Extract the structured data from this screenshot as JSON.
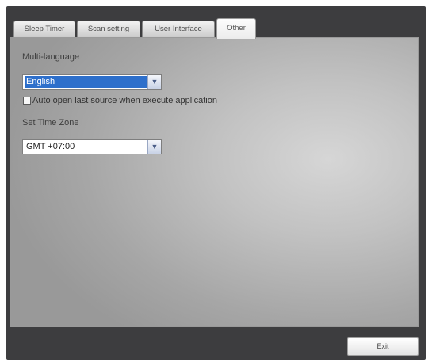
{
  "tabs": [
    {
      "label": "Sleep Timer",
      "active": false
    },
    {
      "label": "Scan setting",
      "active": false
    },
    {
      "label": "User Interface",
      "active": false
    },
    {
      "label": "Other",
      "active": true
    }
  ],
  "language": {
    "label": "Multi-language",
    "value": "English"
  },
  "auto_open": {
    "label": "Auto open last source when execute application",
    "checked": false
  },
  "timezone": {
    "label": "Set Time Zone",
    "value": "GMT +07:00"
  },
  "exit_button": {
    "label": "Exit"
  },
  "icons": {
    "dropdown": "chevron-down-icon"
  },
  "colors": {
    "selection": "#2d6fcb",
    "window_frame": "#3d3d3f"
  }
}
